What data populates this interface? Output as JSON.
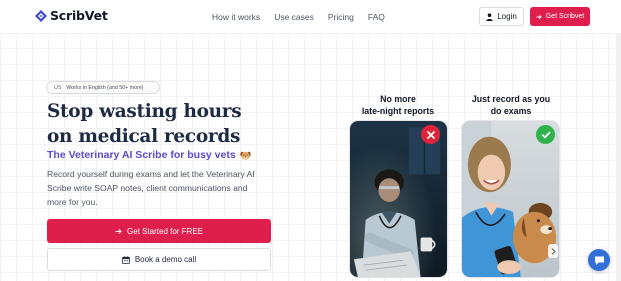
{
  "brand": {
    "name": "ScribVet",
    "logo_icon": "scribvet-logo-icon",
    "color": "#de1f4b"
  },
  "nav": {
    "links": [
      "How it works",
      "Use cases",
      "Pricing",
      "FAQ"
    ],
    "login_label": "Login",
    "login_icon": "person-icon",
    "cta_label": "Get Scribvet",
    "cta_icon": "arrow-right-icon"
  },
  "hero": {
    "lang_code": "US",
    "lang_text": "Works in English (and 50+ more)",
    "headline_line1": "Stop wasting hours",
    "headline_line2": "on medical records",
    "subhead": "The Veterinary AI Scribe for busy vets",
    "subhead_icon": "dog-face-icon",
    "description": "Record yourself during exams and let the Veterinary AI Scribe write SOAP notes, client communications and more for you.",
    "cta_primary": "Get Started for FREE",
    "cta_secondary": "Book a demo call",
    "cta_secondary_icon": "calendar-icon"
  },
  "comparison": {
    "left_label_line1": "No more",
    "left_label_line2": "late-night reports",
    "left_icon": "red-x-icon",
    "right_label_line1": "Just record as you",
    "right_label_line2": "do exams",
    "right_icon": "green-check-icon"
  },
  "colors": {
    "accent": "#de1f4b",
    "subhead": "#5a4bcf",
    "headline": "#1f2a44",
    "error": "#e0243b",
    "success": "#2fb24a",
    "chat": "#2f6fd6"
  },
  "chat_icon": "chat-bubble-icon"
}
